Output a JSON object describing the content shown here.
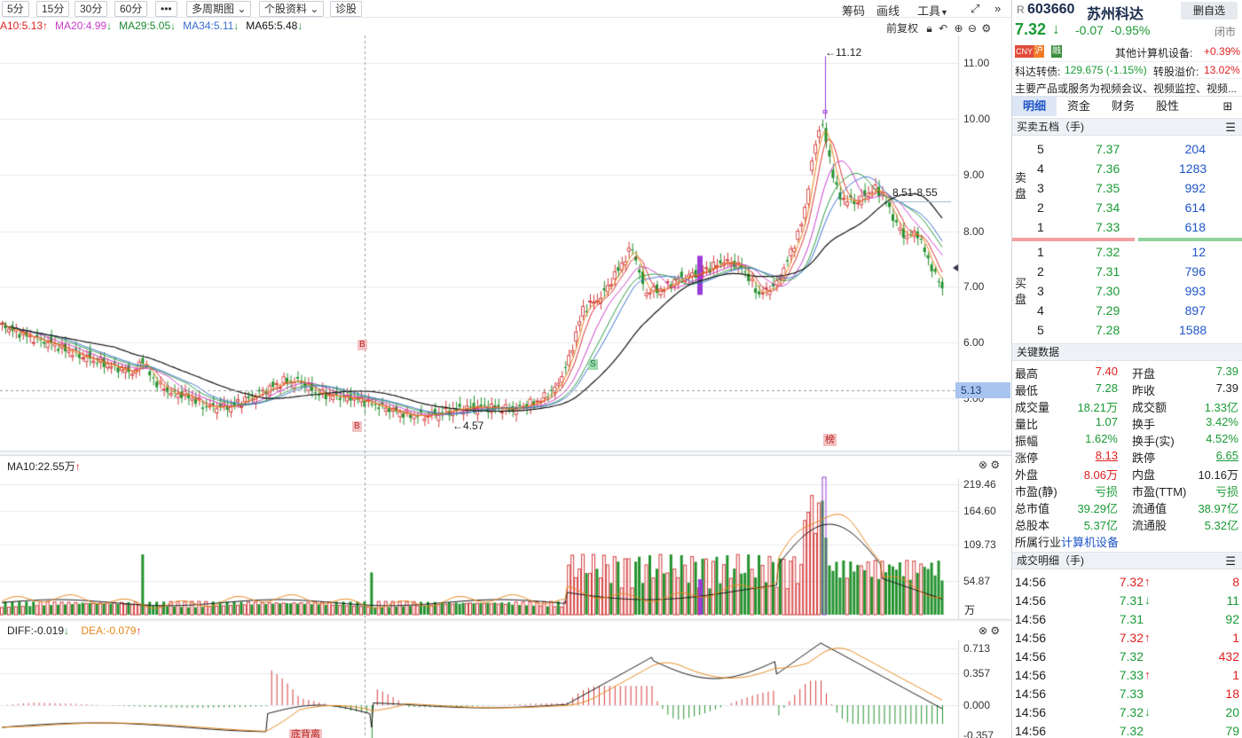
{
  "toolbar": {
    "periods": [
      "5分",
      "15分",
      "30分",
      "60分"
    ],
    "more": "•••",
    "multi_period": "多周期图",
    "stock_info": "个股资料",
    "diagnose": "诊股",
    "right_tools": [
      "筹码",
      "画线",
      "工具"
    ]
  },
  "ma_legend": [
    {
      "label": "A10:5.13",
      "arrow": "↑",
      "color": "#e02020"
    },
    {
      "label": "MA20:4.99",
      "arrow": "↓",
      "color": "#c83cc8"
    },
    {
      "label": "MA29:5.05",
      "arrow": "↓",
      "color": "#1a8a2e"
    },
    {
      "label": "MA34:5.11",
      "arrow": "↓",
      "color": "#3a6fd0"
    },
    {
      "label": "MA65:5.48",
      "arrow": "↓",
      "color": "#111111"
    }
  ],
  "chart_header": {
    "adjust": "前复权"
  },
  "price_axis": {
    "ticks": [
      "11.00",
      "10.00",
      "9.00",
      "8.00",
      "7.00",
      "6.00",
      "5.00"
    ],
    "pointer": "5.13"
  },
  "annotations": {
    "high": "←11.12",
    "low": "←4.57",
    "range": "8.51-8.55",
    "b_upper": "B",
    "b_lower": "B",
    "s_mark": "S",
    "rank": "榜"
  },
  "volume_panel": {
    "title": "MA10:22.55万",
    "arrow": "↑",
    "ticks": [
      "219.46",
      "164.60",
      "109.73",
      "54.87"
    ],
    "unit": "万"
  },
  "macd_panel": {
    "diff": "DIFF:-0.019",
    "diff_arrow": "↓",
    "dea": "DEA:-0.079",
    "dea_arrow": "↑",
    "ticks": [
      "0.713",
      "0.357",
      "0.000",
      "-0.357"
    ],
    "label": "底背离"
  },
  "stock": {
    "prefix": "R",
    "code": "603660",
    "name": "苏州科达",
    "watch_button": "删自选",
    "price": "7.32",
    "arrow": "↓",
    "change": "-0.07",
    "pct": "-0.95%",
    "status": "闭市",
    "badges": [
      "CNY",
      "沪",
      "融"
    ],
    "industry_label": "其他计算机设备:",
    "industry_pct": "+0.39%",
    "bond_label": "科达转债:",
    "bond_value": "129.675 (-1.15%)",
    "premium_label": "转股溢价:",
    "premium_value": "13.02%",
    "business": "主要产品或服务为视频会议、视频监控、视频..."
  },
  "tabs": [
    "明细",
    "资金",
    "财务",
    "股性"
  ],
  "order_book": {
    "title": "买卖五档（手)",
    "sell_label": "卖盘",
    "buy_label": "买盘",
    "asks": [
      {
        "lvl": "5",
        "price": "7.37",
        "vol": "204"
      },
      {
        "lvl": "4",
        "price": "7.36",
        "vol": "1283"
      },
      {
        "lvl": "3",
        "price": "7.35",
        "vol": "992"
      },
      {
        "lvl": "2",
        "price": "7.34",
        "vol": "614"
      },
      {
        "lvl": "1",
        "price": "7.33",
        "vol": "618"
      }
    ],
    "bids": [
      {
        "lvl": "1",
        "price": "7.32",
        "vol": "12"
      },
      {
        "lvl": "2",
        "price": "7.31",
        "vol": "796"
      },
      {
        "lvl": "3",
        "price": "7.30",
        "vol": "993"
      },
      {
        "lvl": "4",
        "price": "7.29",
        "vol": "897"
      },
      {
        "lvl": "5",
        "price": "7.28",
        "vol": "1588"
      }
    ]
  },
  "key_data": {
    "title": "关键数据",
    "rows": [
      [
        {
          "k": "最高",
          "v": "7.40",
          "c": "red"
        },
        {
          "k": "开盘",
          "v": "7.39",
          "c": "green"
        }
      ],
      [
        {
          "k": "最低",
          "v": "7.28",
          "c": "green"
        },
        {
          "k": "昨收",
          "v": "7.39",
          "c": "dark"
        }
      ],
      [
        {
          "k": "成交量",
          "v": "18.21万",
          "c": "green"
        },
        {
          "k": "成交额",
          "v": "1.33亿",
          "c": "green"
        }
      ],
      [
        {
          "k": "量比",
          "v": "1.07",
          "c": "green"
        },
        {
          "k": "换手",
          "v": "3.42%",
          "c": "green"
        }
      ],
      [
        {
          "k": "振幅",
          "v": "1.62%",
          "c": "green"
        },
        {
          "k": "换手(实)",
          "v": "4.52%",
          "c": "green"
        }
      ],
      [
        {
          "k": "涨停",
          "v": "8.13",
          "c": "red"
        },
        {
          "k": "跌停",
          "v": "6.65",
          "c": "green"
        }
      ],
      [
        {
          "k": "外盘",
          "v": "8.06万",
          "c": "red"
        },
        {
          "k": "内盘",
          "v": "10.16万",
          "c": "dark"
        }
      ],
      [
        {
          "k": "市盈(静)",
          "v": "亏损",
          "c": "green"
        },
        {
          "k": "市盈(TTM)",
          "v": "亏损",
          "c": "green"
        }
      ],
      [
        {
          "k": "总市值",
          "v": "39.29亿",
          "c": "green"
        },
        {
          "k": "流通值",
          "v": "38.97亿",
          "c": "green"
        }
      ],
      [
        {
          "k": "总股本",
          "v": "5.37亿",
          "c": "green"
        },
        {
          "k": "流通股",
          "v": "5.32亿",
          "c": "green"
        }
      ]
    ],
    "industry_label": "所属行业",
    "industry_value": "计算机设备"
  },
  "ticks": {
    "title": "成交明细（手)",
    "rows": [
      {
        "time": "14:56",
        "price": "7.32",
        "dir": "↑",
        "vol": "8",
        "pc": "red",
        "vc": "red"
      },
      {
        "time": "14:56",
        "price": "7.31",
        "dir": "↓",
        "vol": "11",
        "pc": "green",
        "vc": "green"
      },
      {
        "time": "14:56",
        "price": "7.31",
        "dir": "",
        "vol": "92",
        "pc": "green",
        "vc": "green"
      },
      {
        "time": "14:56",
        "price": "7.32",
        "dir": "↑",
        "vol": "1",
        "pc": "red",
        "vc": "red"
      },
      {
        "time": "14:56",
        "price": "7.32",
        "dir": "",
        "vol": "432",
        "pc": "green",
        "vc": "red"
      },
      {
        "time": "14:56",
        "price": "7.33",
        "dir": "↑",
        "vol": "1",
        "pc": "green",
        "vc": "red"
      },
      {
        "time": "14:56",
        "price": "7.33",
        "dir": "",
        "vol": "18",
        "pc": "green",
        "vc": "red"
      },
      {
        "time": "14:56",
        "price": "7.32",
        "dir": "↓",
        "vol": "20",
        "pc": "green",
        "vc": "green"
      },
      {
        "time": "14:56",
        "price": "7.32",
        "dir": "",
        "vol": "79",
        "pc": "green",
        "vc": "green"
      }
    ]
  },
  "colors": {
    "up": "#d33b3b",
    "down": "#23922e",
    "purple": "#9b3cd6",
    "orange": "#e8861a",
    "accent": "#1f55c8"
  }
}
